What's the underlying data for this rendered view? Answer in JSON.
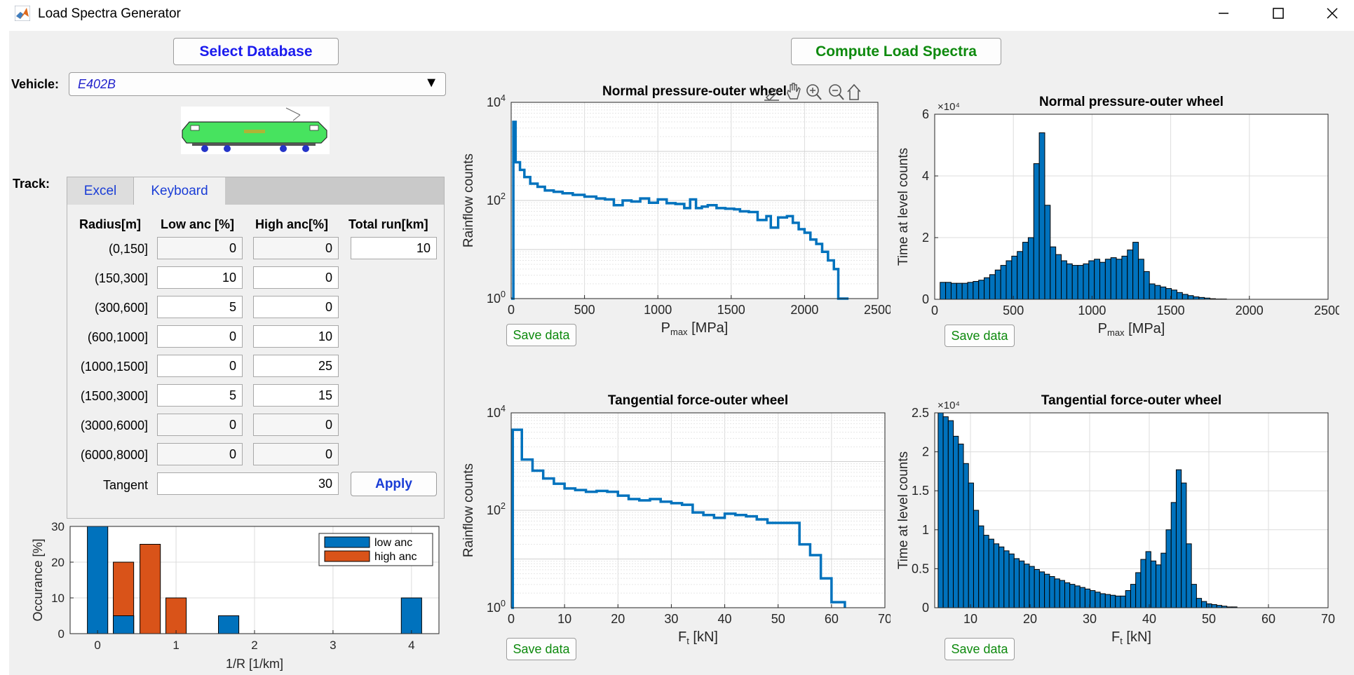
{
  "window": {
    "title": "Load Spectra Generator",
    "accent": "#0072bd",
    "histogram_color": "#0072bd",
    "high_color": "#d95319"
  },
  "buttons": {
    "select_database": "Select Database",
    "compute": "Compute Load Spectra",
    "apply": "Apply",
    "save_data": "Save data"
  },
  "vehicle": {
    "label": "Vehicle:",
    "selected": "E402B"
  },
  "track": {
    "label": "Track:",
    "tabs": [
      {
        "label": "Excel",
        "active": false
      },
      {
        "label": "Keyboard",
        "active": true
      }
    ],
    "columns": [
      "Radius[m]",
      "Low anc [%]",
      "High anc[%]",
      "Total run[km]"
    ],
    "rows": [
      {
        "radius": "(0,150]",
        "low": "0",
        "high": "0",
        "enabled": false
      },
      {
        "radius": "(150,300]",
        "low": "10",
        "high": "0",
        "enabled": true
      },
      {
        "radius": "(300,600]",
        "low": "5",
        "high": "0",
        "enabled": true
      },
      {
        "radius": "(600,1000]",
        "low": "0",
        "high": "10",
        "enabled": true
      },
      {
        "radius": "(1000,1500]",
        "low": "0",
        "high": "25",
        "enabled": true
      },
      {
        "radius": "(1500,3000]",
        "low": "5",
        "high": "15",
        "enabled": true
      },
      {
        "radius": "(3000,6000]",
        "low": "0",
        "high": "0",
        "enabled": false
      },
      {
        "radius": "(6000,8000]",
        "low": "0",
        "high": "0",
        "enabled": false
      }
    ],
    "total_run": "10",
    "tangent_label": "Tangent",
    "tangent_value": "30"
  },
  "chart_data": [
    {
      "id": "occurance",
      "type": "bar",
      "title": "",
      "xlabel": "1/R [1/km]",
      "ylabel": "Occurance [%]",
      "xlim": [
        -0.35,
        4.35
      ],
      "ylim": [
        0,
        30
      ],
      "xticks": [
        "0",
        "1",
        "2",
        "3",
        "4"
      ],
      "yticks": [
        "0",
        "10",
        "20",
        "30"
      ],
      "legend": "top-right",
      "bar_width": 0.26,
      "series": [
        {
          "name": "low anc",
          "color": "#0072bd",
          "x": [
            0,
            0.33,
            1.67,
            4
          ],
          "values": [
            30,
            5,
            5,
            10
          ]
        },
        {
          "name": "high anc",
          "color": "#d95319",
          "x": [
            0.33,
            0.67,
            1
          ],
          "values": [
            20,
            25,
            10
          ]
        }
      ]
    },
    {
      "id": "pressure-rainflow",
      "type": "line",
      "title": "Normal pressure-outer wheel",
      "xlabel": "Pmax [MPa]",
      "ylabel": "Rainflow counts",
      "xlim": [
        0,
        2500
      ],
      "ylim": [
        1,
        10000
      ],
      "yscale": "log",
      "xticks": [
        "0",
        "500",
        "1000",
        "1500",
        "2000",
        "2500"
      ],
      "grid": true,
      "x": [
        0,
        15,
        30,
        60,
        90,
        130,
        180,
        230,
        290,
        350,
        420,
        500,
        580,
        640,
        700,
        760,
        820,
        880,
        940,
        1000,
        1060,
        1120,
        1180,
        1220,
        1260,
        1300,
        1340,
        1400,
        1460,
        1520,
        1560,
        1620,
        1680,
        1740,
        1770,
        1820,
        1880,
        1920,
        1960,
        2000,
        2040,
        2080,
        2120,
        2160,
        2200,
        2230,
        2250,
        2300
      ],
      "values": [
        1,
        4000,
        600,
        420,
        300,
        220,
        190,
        160,
        150,
        140,
        130,
        120,
        110,
        105,
        80,
        100,
        95,
        110,
        90,
        105,
        88,
        85,
        70,
        105,
        70,
        75,
        80,
        70,
        68,
        66,
        60,
        58,
        40,
        48,
        28,
        45,
        48,
        35,
        26,
        22,
        16,
        13,
        9,
        6,
        4,
        1,
        0.3,
        0.3
      ]
    },
    {
      "id": "pressure-time",
      "type": "bar",
      "title": "Normal pressure-outer wheel",
      "xlabel": "Pmax [MPa]",
      "ylabel": "Time at level counts",
      "exponent": "×10⁴",
      "xlim": [
        0,
        2500
      ],
      "ylim": [
        0,
        6
      ],
      "xticks": [
        "0",
        "500",
        "1000",
        "1500",
        "2000",
        "2500"
      ],
      "yticks": [
        "0",
        "2",
        "4",
        "6"
      ],
      "grid": true,
      "bin_width": 35,
      "x": [
        52,
        87,
        122,
        157,
        192,
        227,
        262,
        297,
        332,
        367,
        402,
        437,
        472,
        507,
        542,
        577,
        612,
        647,
        682,
        717,
        752,
        787,
        822,
        857,
        892,
        927,
        962,
        997,
        1032,
        1067,
        1102,
        1137,
        1172,
        1207,
        1242,
        1277,
        1312,
        1347,
        1382,
        1417,
        1452,
        1487,
        1522,
        1557,
        1592,
        1627,
        1662,
        1697,
        1732,
        1767,
        1802,
        1837,
        1872,
        1907
      ],
      "values": [
        0.55,
        0.55,
        0.52,
        0.52,
        0.52,
        0.55,
        0.58,
        0.62,
        0.7,
        0.8,
        0.95,
        1.1,
        1.25,
        1.4,
        1.55,
        1.85,
        2.0,
        4.4,
        5.4,
        3.05,
        1.7,
        1.45,
        1.25,
        1.15,
        1.1,
        1.1,
        1.15,
        1.25,
        1.3,
        1.2,
        1.3,
        1.35,
        1.3,
        1.4,
        1.6,
        1.85,
        1.3,
        0.9,
        0.5,
        0.45,
        0.4,
        0.35,
        0.3,
        0.22,
        0.16,
        0.12,
        0.08,
        0.06,
        0.04,
        0.02,
        0.01,
        0.01,
        0,
        0
      ]
    },
    {
      "id": "force-rainflow",
      "type": "line",
      "title": "Tangential force-outer wheel",
      "xlabel": "Ft [kN]",
      "ylabel": "Rainflow counts",
      "xlim": [
        0,
        70
      ],
      "ylim": [
        1,
        10000
      ],
      "yscale": "log",
      "xticks": [
        "0",
        "10",
        "20",
        "30",
        "40",
        "50",
        "60",
        "70"
      ],
      "grid": true,
      "x": [
        0,
        0.3,
        2,
        4,
        6,
        8,
        10,
        12,
        14,
        16,
        18,
        20,
        22,
        24,
        26,
        28,
        30,
        32,
        34,
        36,
        38,
        40,
        42,
        44,
        46,
        48,
        50,
        52,
        54,
        56,
        58,
        60,
        62.5
      ],
      "values": [
        1,
        4500,
        1100,
        650,
        450,
        350,
        280,
        260,
        240,
        250,
        240,
        200,
        170,
        160,
        170,
        150,
        140,
        130,
        90,
        80,
        70,
        85,
        80,
        75,
        65,
        55,
        55,
        55,
        20,
        12,
        4,
        1.3,
        0.3
      ]
    },
    {
      "id": "force-time",
      "type": "bar",
      "title": "Tangential force-outer wheel",
      "xlabel": "Ft [kN]",
      "ylabel": "Time at level counts",
      "exponent": "×10⁴",
      "xlim": [
        4,
        70
      ],
      "ylim": [
        0,
        2.5
      ],
      "xticks": [
        "10",
        "20",
        "30",
        "40",
        "50",
        "60",
        "70"
      ],
      "yticks": [
        "0",
        "0.5",
        "1",
        "1.5",
        "2",
        "2.5"
      ],
      "grid": true,
      "bin_width": 0.85,
      "x": [
        5,
        5.85,
        6.7,
        7.55,
        8.4,
        9.25,
        10.1,
        10.95,
        11.8,
        12.65,
        13.5,
        14.35,
        15.2,
        16.05,
        16.9,
        17.75,
        18.6,
        19.45,
        20.3,
        21.15,
        22.0,
        22.85,
        23.7,
        24.55,
        25.4,
        26.25,
        27.1,
        27.95,
        28.8,
        29.65,
        30.5,
        31.35,
        32.2,
        33.05,
        33.9,
        34.75,
        35.6,
        36.45,
        37.3,
        38.15,
        39.0,
        39.85,
        40.7,
        41.55,
        42.4,
        43.25,
        44.1,
        44.95,
        45.8,
        46.65,
        47.5,
        48.35,
        49.2,
        50.05,
        50.9,
        51.75,
        52.6,
        53.45,
        54.3
      ],
      "values": [
        2.5,
        2.45,
        2.4,
        2.2,
        2.1,
        1.85,
        1.6,
        1.25,
        1.05,
        0.93,
        0.88,
        0.82,
        0.78,
        0.73,
        0.69,
        0.63,
        0.6,
        0.56,
        0.53,
        0.49,
        0.46,
        0.43,
        0.4,
        0.37,
        0.35,
        0.32,
        0.3,
        0.28,
        0.26,
        0.24,
        0.22,
        0.2,
        0.18,
        0.17,
        0.16,
        0.15,
        0.15,
        0.22,
        0.3,
        0.45,
        0.62,
        0.72,
        0.6,
        0.55,
        0.7,
        1.0,
        1.35,
        1.77,
        1.6,
        0.82,
        0.3,
        0.12,
        0.08,
        0.05,
        0.04,
        0.03,
        0.02,
        0.01,
        0.01
      ]
    }
  ]
}
